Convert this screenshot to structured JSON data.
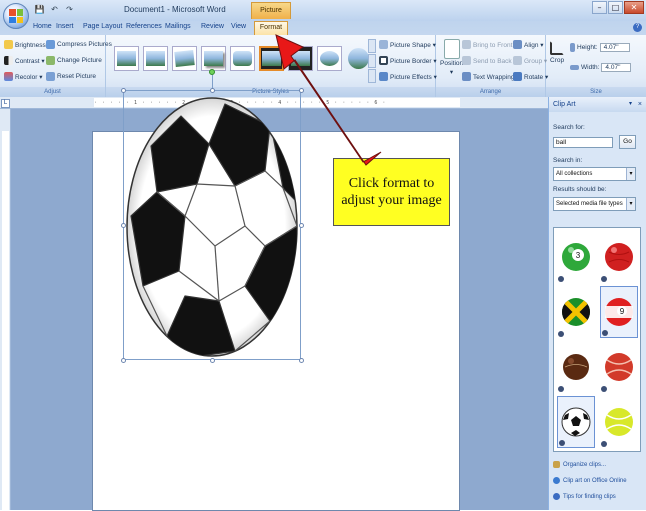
{
  "window": {
    "title": "Document1 - Microsoft Word",
    "contextual_tab_group": "Picture Tools",
    "controls": {
      "minimize": "–",
      "maximize": "□",
      "close": "✕"
    }
  },
  "quick_access": {
    "save": "💾",
    "undo": "↶",
    "redo": "↷"
  },
  "tabs": [
    "Home",
    "Insert",
    "Page Layout",
    "References",
    "Mailings",
    "Review",
    "View",
    "Format"
  ],
  "help": "?",
  "ribbon": {
    "adjust": {
      "label": "Adjust",
      "brightness": "Brightness ▾",
      "contrast": "Contrast ▾",
      "recolor": "Recolor ▾",
      "compress": "Compress Pictures",
      "change": "Change Picture",
      "reset": "Reset Picture"
    },
    "picture_styles": {
      "label": "Picture Styles",
      "shape": "Picture Shape ▾",
      "border": "Picture Border ▾",
      "effects": "Picture Effects ▾"
    },
    "arrange": {
      "label": "Arrange",
      "position": "Position",
      "position_arrow": "▾",
      "bring_front": "Bring to Front ▾",
      "send_back": "Send to Back ▾",
      "text_wrapping": "Text Wrapping ▾",
      "align": "Align ▾",
      "group": "Group ▾",
      "rotate": "Rotate ▾"
    },
    "size": {
      "label": "Size",
      "crop": "Crop",
      "height_label": "Height:",
      "height_value": "4.07\"",
      "width_label": "Width:",
      "width_value": "4.07\""
    }
  },
  "ruler": {
    "corner": "L"
  },
  "callout": {
    "text": "Click format to adjust your image"
  },
  "clip_art": {
    "title": "Clip Art",
    "close": "×",
    "menu": "▾",
    "search_label": "Search for:",
    "search_value": "ball",
    "go": "Go",
    "search_in_label": "Search in:",
    "search_in_value": "All collections",
    "results_label": "Results should be:",
    "results_value": "Selected media file types",
    "dropdown_arrow": "▾",
    "results": [
      {
        "name": "billiard-ball-3",
        "color": "#2ea83a",
        "label": "3"
      },
      {
        "name": "red-ball",
        "color": "#d02020",
        "label": ""
      },
      {
        "name": "jamaica-flag-ball",
        "color": "#f2c200",
        "label": ""
      },
      {
        "name": "billiard-ball-9",
        "color": "#e02020",
        "label": "9"
      },
      {
        "name": "brown-ball",
        "color": "#5a2a12",
        "label": ""
      },
      {
        "name": "tennis-ball-red",
        "color": "#d23a2a",
        "label": ""
      },
      {
        "name": "soccer-ball",
        "color": "#ffffff",
        "label": ""
      },
      {
        "name": "tennis-ball",
        "color": "#d8e82a",
        "label": ""
      }
    ],
    "links": [
      "Organize clips...",
      "Clip art on Office Online",
      "Tips for finding clips"
    ]
  },
  "colors": {
    "accent_orange": "#f0b04a",
    "ribbon_blue": "#cfdef2",
    "arrow_red": "#e81818",
    "callout_yellow": "#ffff22"
  }
}
